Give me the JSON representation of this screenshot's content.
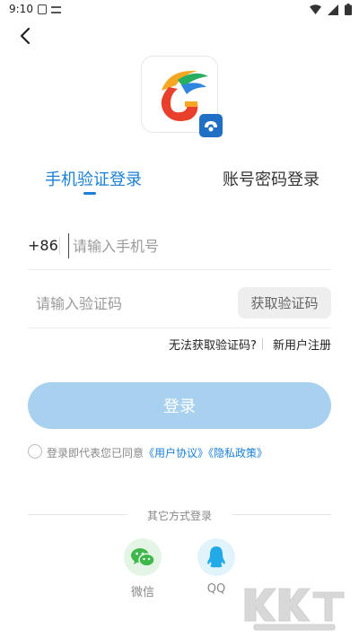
{
  "status_bar": {
    "time": "9:10"
  },
  "tabs": {
    "phone_login": "手机验证登录",
    "password_login": "账号密码登录"
  },
  "phone": {
    "country_code": "+86",
    "placeholder": "请输入手机号"
  },
  "verify": {
    "placeholder": "请输入验证码",
    "get_code_label": "获取验证码"
  },
  "links": {
    "no_code": "无法获取验证码?",
    "register": "新用户注册"
  },
  "login_button": "登录",
  "agreement": {
    "prefix": "登录即代表您已同意",
    "user_agreement": "《用户协议》",
    "privacy_policy": "《隐私政策》"
  },
  "other_login": {
    "title": "其它方式登录",
    "wechat": "微信",
    "qq": "QQ"
  },
  "colors": {
    "accent": "#1a7fd6",
    "login_btn": "#a7d1ef"
  }
}
